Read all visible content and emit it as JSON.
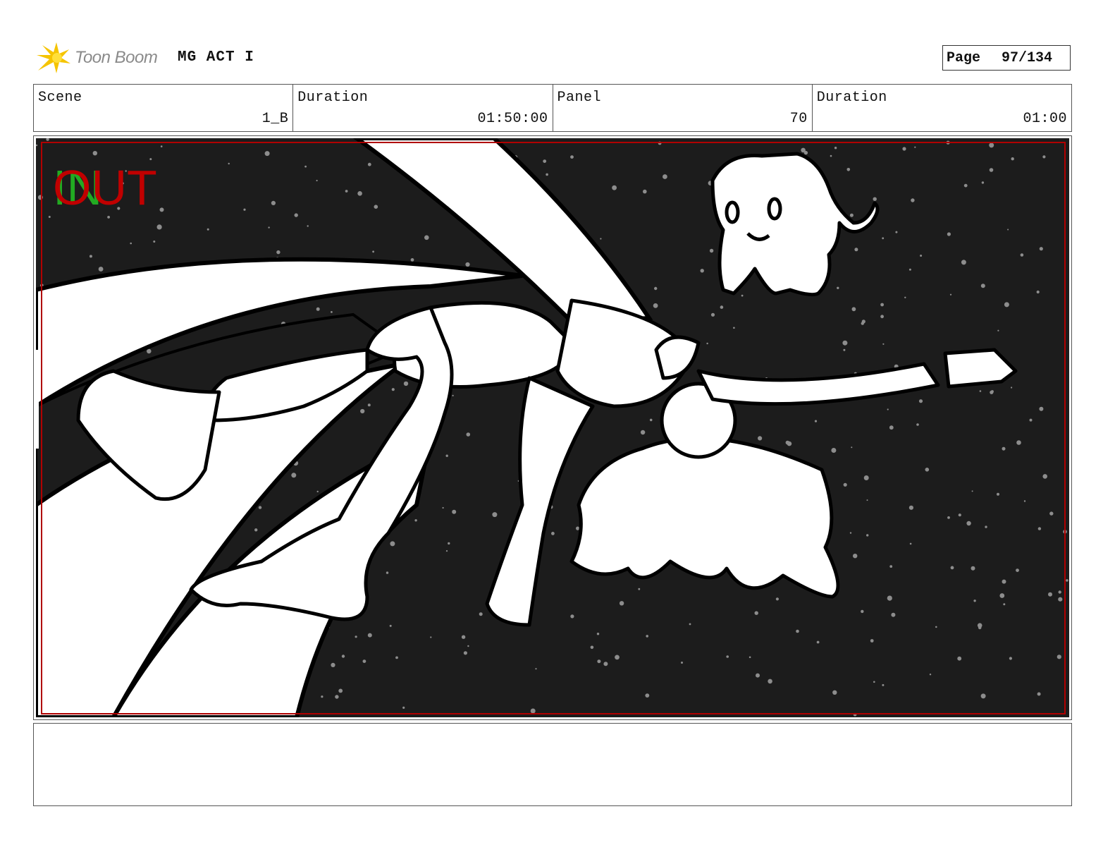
{
  "header": {
    "brand": "Toon Boom",
    "project": "MG ACT I",
    "page_label": "Page",
    "page_number": "97/134"
  },
  "info": [
    {
      "label": "Scene",
      "value": "1_B"
    },
    {
      "label": "Duration",
      "value": "01:50:00"
    },
    {
      "label": "Panel",
      "value": "70"
    },
    {
      "label": "Duration",
      "value": "01:00"
    }
  ],
  "panel": {
    "in_marker": "IN",
    "out_marker": "OUT",
    "in_color": "#22aa22",
    "out_color": "#c00000",
    "safe_frame_color": "#b00000",
    "background_color": "#1c1c1c"
  },
  "notes": ""
}
